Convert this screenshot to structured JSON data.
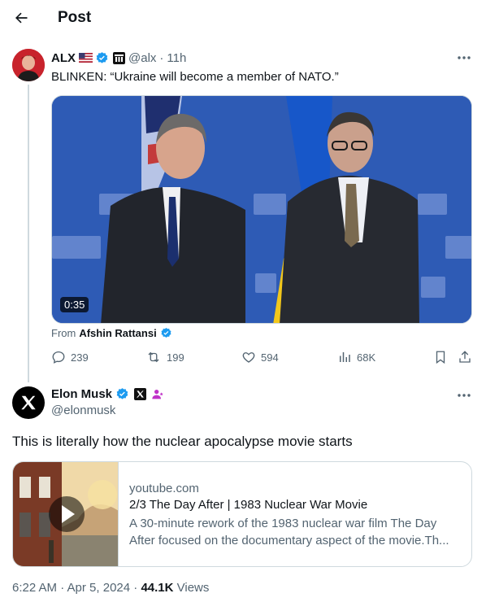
{
  "header": {
    "title": "Post"
  },
  "parent_tweet": {
    "name": "ALX",
    "handle": "@alx",
    "time": "11h",
    "text": "BLINKEN: “Ukraine will become a member of NATO.”",
    "video_duration": "0:35",
    "from_prefix": "From",
    "from_source": "Afshin Rattansi",
    "replies": "239",
    "reposts": "199",
    "likes": "594",
    "views": "68K"
  },
  "main_tweet": {
    "name": "Elon Musk",
    "handle": "@elonmusk",
    "text": "This is literally how the nuclear apocalypse movie starts",
    "card": {
      "domain": "youtube.com",
      "title": "2/3 The Day After | 1983 Nuclear War Movie",
      "description": "A 30-minute rework of the 1983 nuclear war film The Day After focused on the documentary aspect of the movie.Th..."
    },
    "meta": {
      "datetime": "6:22 AM · Apr 5, 2024 · ",
      "views_count": "44.1K",
      "views_label": " Views"
    }
  },
  "colors": {
    "verified": "#1d9bf0",
    "muted": "#536471",
    "border": "#cfd9de",
    "text": "#0f1419"
  },
  "icons": [
    "back-arrow-icon",
    "verified-badge-icon",
    "more-icon",
    "reply-icon",
    "repost-icon",
    "like-icon",
    "views-icon",
    "bookmark-icon",
    "share-icon",
    "play-icon",
    "x-logo-icon"
  ]
}
